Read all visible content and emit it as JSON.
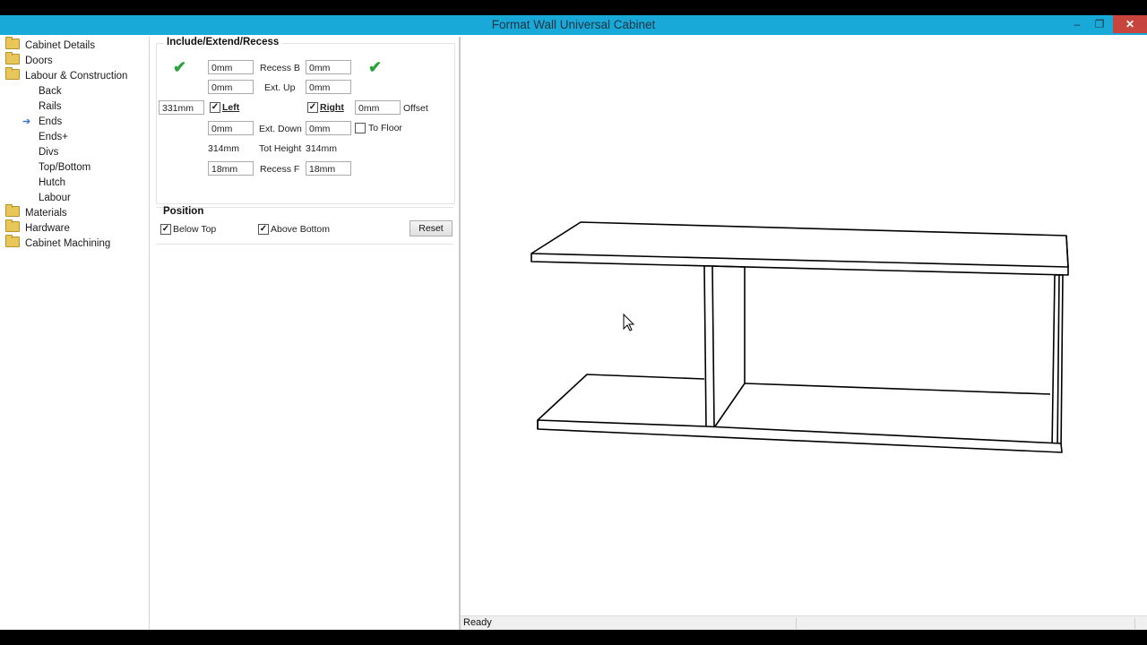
{
  "window": {
    "title": "Format Wall Universal Cabinet",
    "controls": {
      "minimize": "–",
      "restore": "❐",
      "close": "✕"
    }
  },
  "tree": {
    "items": [
      {
        "label": "Cabinet Details",
        "type": "folder"
      },
      {
        "label": "Doors",
        "type": "folder"
      },
      {
        "label": "Labour & Construction",
        "type": "folder"
      },
      {
        "label": "Back",
        "type": "child"
      },
      {
        "label": "Rails",
        "type": "child"
      },
      {
        "label": "Ends",
        "type": "child",
        "selected": true
      },
      {
        "label": "Ends+",
        "type": "child"
      },
      {
        "label": "Divs",
        "type": "child"
      },
      {
        "label": "Top/Bottom",
        "type": "child"
      },
      {
        "label": "Hutch",
        "type": "child"
      },
      {
        "label": "Labour",
        "type": "child"
      },
      {
        "label": "Materials",
        "type": "folder"
      },
      {
        "label": "Hardware",
        "type": "folder"
      },
      {
        "label": "Cabinet Machining",
        "type": "folder"
      }
    ]
  },
  "include": {
    "title": "Include/Extend/Recess",
    "left_recess_b": "0mm",
    "recess_b_label": "Recess B",
    "right_recess_b": "0mm",
    "left_ext_up": "0mm",
    "ext_up_label": "Ext. Up",
    "right_ext_up": "0mm",
    "left_width": "331mm",
    "left_label": "Left",
    "left_checked": true,
    "right_label": "Right",
    "right_checked": true,
    "offset_value": "0mm",
    "offset_label": "Offset",
    "left_ext_down": "0mm",
    "ext_down_label": "Ext. Down",
    "right_ext_down": "0mm",
    "to_floor_label": "To Floor",
    "to_floor_checked": false,
    "left_tot_height": "314mm",
    "tot_height_label": "Tot Height",
    "right_tot_height": "314mm",
    "left_recess_f": "18mm",
    "recess_f_label": "Recess F",
    "right_recess_f": "18mm",
    "checkmark": "✔"
  },
  "position": {
    "title": "Position",
    "below_top_label": "Below Top",
    "below_top_checked": true,
    "above_bottom_label": "Above Bottom",
    "above_bottom_checked": true,
    "reset_label": "Reset"
  },
  "status": {
    "text": "Ready"
  },
  "colors": {
    "titlebar": "#19a9d9",
    "close_button": "#c7453c",
    "checkmark_green": "#2aa33b",
    "selection_arrow": "#2b6fd6",
    "folder": "#e8c65a"
  }
}
